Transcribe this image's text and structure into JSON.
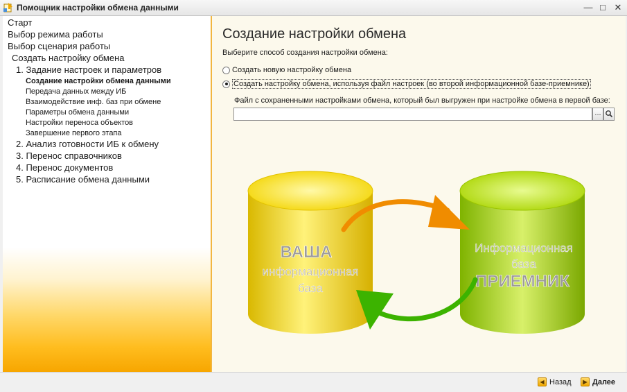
{
  "window": {
    "title": "Помощник настройки обмена данными",
    "icon": "app-icon",
    "controls": [
      "minimize-icon",
      "maximize-icon",
      "close-icon"
    ]
  },
  "sidebar": {
    "items": [
      {
        "label": "Старт",
        "level": 0
      },
      {
        "label": "Выбор режима работы",
        "level": 0
      },
      {
        "label": "Выбор сценария работы",
        "level": 0
      },
      {
        "label": "Создать настройку обмена",
        "level": 1
      },
      {
        "label": "1.  Задание настроек и параметров",
        "level": 2
      },
      {
        "label": "Создание настройки обмена данными",
        "level": 3,
        "current": true
      },
      {
        "label": "Передача данных между ИБ",
        "level": 3
      },
      {
        "label": "Взаимодействие инф. баз при обмене",
        "level": 3
      },
      {
        "label": "Параметры обмена данными",
        "level": 3
      },
      {
        "label": "Настройки переноса объектов",
        "level": 3
      },
      {
        "label": "Завершение первого этапа",
        "level": 3
      },
      {
        "label": "2.  Анализ готовности ИБ к обмену",
        "level": 2
      },
      {
        "label": "3.  Перенос справочников",
        "level": 2
      },
      {
        "label": "4.  Перенос документов",
        "level": 2
      },
      {
        "label": "5.  Расписание обмена данными",
        "level": 2
      }
    ]
  },
  "main": {
    "heading": "Создание настройки обмена",
    "prompt": "Выберите способ создания настройки обмена:",
    "options": [
      {
        "label": "Создать новую настройку обмена",
        "checked": false
      },
      {
        "label": "Создать настройку обмена, используя файл настроек (во второй информационной базе-приемнике)",
        "checked": true
      }
    ],
    "file_label": "Файл с сохраненными настройками обмена, который был выгружен при настройке обмена в первой базе:",
    "file_value": "",
    "browse_label": "...",
    "illustration": {
      "source": {
        "line1": "ВАША",
        "line2": "информационная",
        "line3": "база",
        "color": "#f5d800"
      },
      "target": {
        "line1": "Информационная",
        "line2": "база",
        "line3": "ПРИЕМНИК",
        "color": "#9ed000"
      },
      "arrow_out_color": "#f08c00",
      "arrow_in_color": "#3cb300"
    }
  },
  "footer": {
    "back_label": "Назад",
    "next_label": "Далее"
  }
}
